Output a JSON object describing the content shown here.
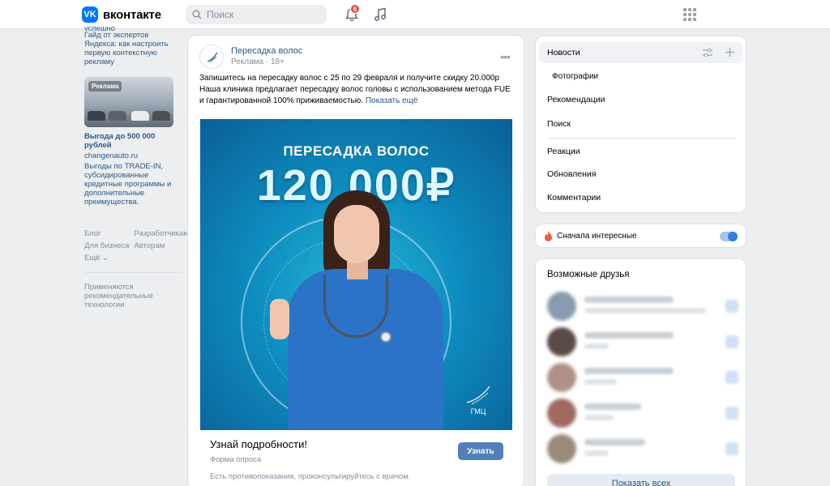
{
  "header": {
    "logo_text": "вконтакте",
    "logo_mark": "VK",
    "search_placeholder": "Поиск",
    "notifications_count": "6",
    "icons": [
      "search-icon",
      "bell-icon",
      "music-icon",
      "apps-grid-icon"
    ]
  },
  "left": {
    "promo_tail": "успешно",
    "promo_lines": [
      "Гайд от экспертов",
      "Яндекса: как настроить",
      "первую контекстную",
      "рекламу"
    ],
    "ad_tag": "Реклама",
    "ad_title": "Выгода до 500 000 рублей",
    "ad_domain": "changenauto.ru",
    "ad_desc": "Выгоды по TRADE-IN, субсидированные кредитные программы и дополнительные преимущества.",
    "footer_links": [
      "Блог",
      "Разработчикам",
      "Для бизнеса",
      "Авторам",
      "Ещё ⌄"
    ],
    "rec_note": "Применяются рекомендательные технологии"
  },
  "post": {
    "author": "Пересадка волос",
    "meta": "Реклама · 18+",
    "text": "Запишитесь на пересадку волос с 25 по 29 февраля и получите скидку 20.000р Наша клиника предлагает пересадку волос головы с использованием метода FUE и гарантированной 100% приживаемостью.",
    "show_more": "Показать ещё",
    "image_title": "ПЕРЕСАДКА ВОЛОС",
    "image_price": "120 000₽",
    "image_logo": "ГМЦ",
    "cta_title": "Узнай подробности!",
    "cta_sub": "Форма опроса",
    "cta_button": "Узнать",
    "cta_note": "Есть противопоказания, проконсультируйтесь с врачом."
  },
  "menu": {
    "items": [
      "Новости",
      "Фотографии",
      "Рекомендации",
      "Поиск",
      "Реакции",
      "Обновления",
      "Комментарии"
    ],
    "active": "Новости"
  },
  "sorter": {
    "label": "Сначала интересные",
    "enabled": true
  },
  "friends": {
    "title": "Возможные друзья",
    "show_all": "Показать всех",
    "avatar_colors": [
      "#8a9bb0",
      "#5a4a48",
      "#b09088",
      "#a06a60",
      "#9a8a7a"
    ]
  }
}
